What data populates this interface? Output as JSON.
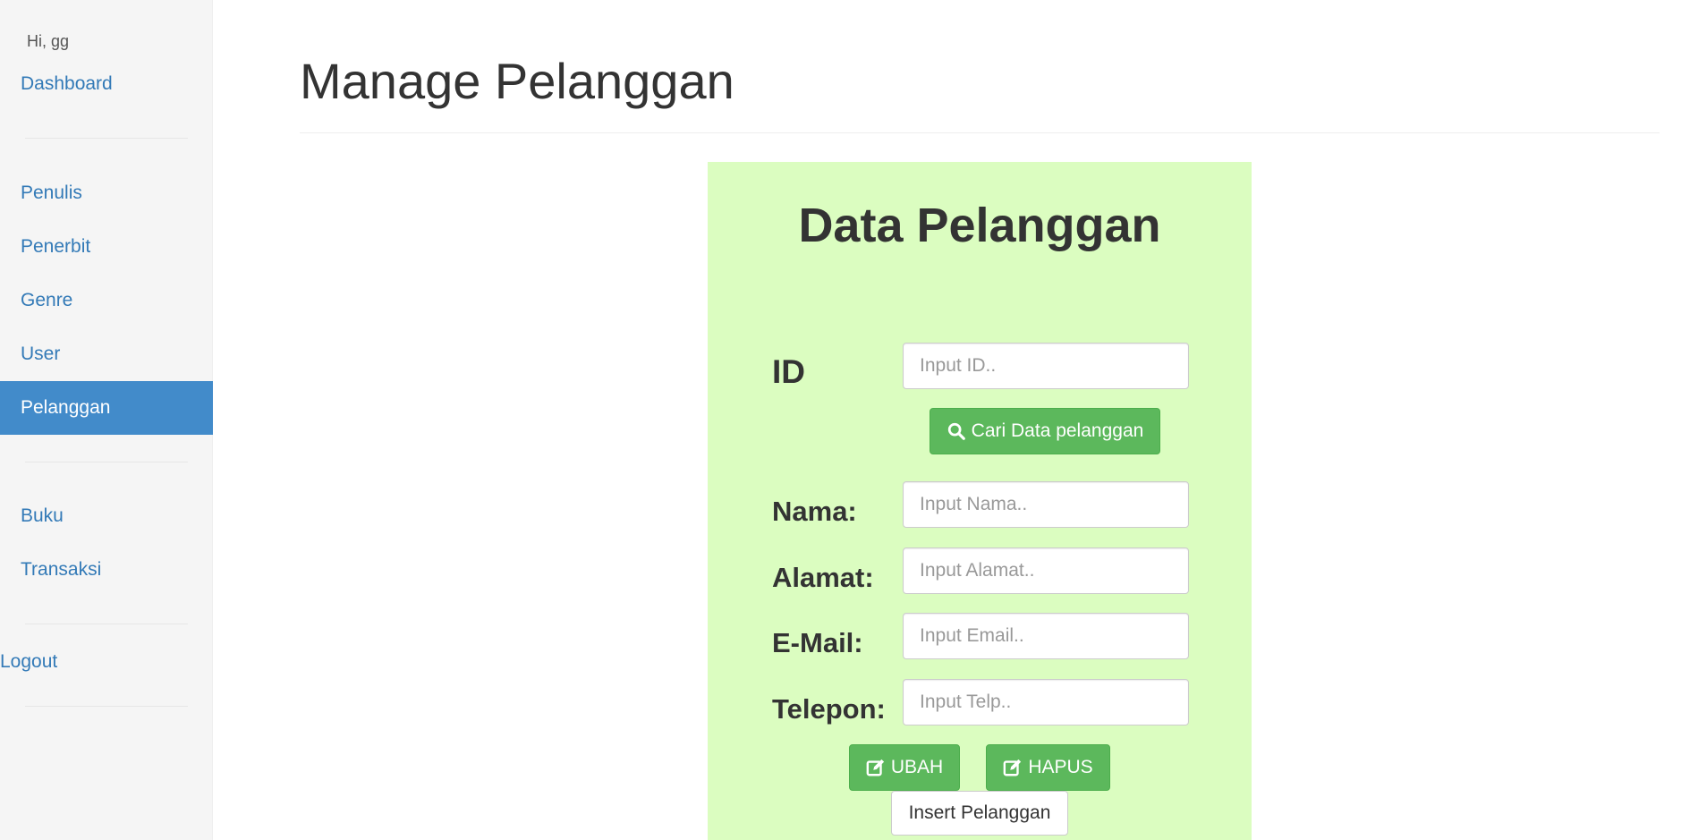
{
  "sidebar": {
    "greeting": "Hi, gg",
    "dashboard": "Dashboard",
    "items": [
      {
        "label": "Penulis"
      },
      {
        "label": "Penerbit"
      },
      {
        "label": "Genre"
      },
      {
        "label": "User"
      },
      {
        "label": "Pelanggan",
        "active": true
      },
      {
        "label": "Buku"
      },
      {
        "label": "Transaksi"
      }
    ],
    "logout": "Logout"
  },
  "main": {
    "page_title": "Manage Pelanggan"
  },
  "form": {
    "title": "Data Pelanggan",
    "id_label": "ID",
    "id_placeholder": "Input ID..",
    "search_button": "Cari Data pelanggan",
    "search_icon": "search-icon",
    "nama_label": "Nama:",
    "nama_placeholder": "Input Nama..",
    "alamat_label": "Alamat:",
    "alamat_placeholder": "Input Alamat..",
    "email_label": "E-Mail:",
    "email_placeholder": "Input Email..",
    "telepon_label": "Telepon:",
    "telepon_placeholder": "Input Telp..",
    "ubah_button": "UBAH",
    "hapus_button": "HAPUS",
    "edit_icon": "edit-icon",
    "insert_button": "Insert Pelanggan"
  },
  "colors": {
    "sidebar_bg": "#f5f5f5",
    "active_bg": "#428bca",
    "link": "#337ab7",
    "panel_bg": "#dbfdc0",
    "button_green": "#5cb85c"
  }
}
